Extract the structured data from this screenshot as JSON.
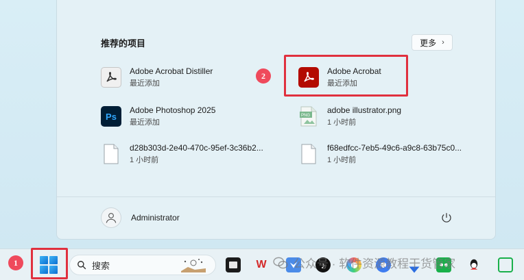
{
  "start_menu": {
    "section_title": "推荐的项目",
    "more_label": "更多",
    "recommended": [
      {
        "name": "Adobe Acrobat Distiller",
        "sub": "最近添加",
        "icon": "acrobat-distiller-icon"
      },
      {
        "name": "Adobe Acrobat",
        "sub": "最近添加",
        "icon": "adobe-acrobat-icon"
      },
      {
        "name": "Adobe Photoshop 2025",
        "sub": "最近添加",
        "icon": "photoshop-icon"
      },
      {
        "name": "adobe illustrator.png",
        "sub": "1 小时前",
        "icon": "png-file-icon"
      },
      {
        "name": "d28b303d-2e40-470c-95ef-3c36b2...",
        "sub": "1 小时前",
        "icon": "file-icon"
      },
      {
        "name": "f68edfcc-7eb5-49c6-a9c8-63b75c0...",
        "sub": "1 小时前",
        "icon": "file-icon"
      }
    ],
    "user_name": "Administrator",
    "ps_label": "Ps",
    "png_label": "PNG"
  },
  "annotations": {
    "badge_1": "1",
    "badge_2": "2",
    "color": "#e0303e"
  },
  "taskbar": {
    "search_label": "搜索",
    "watermark": "公众号 · 软件资源教程干货管家"
  },
  "colors": {
    "accent": "#0b6ed1",
    "acrobat": "#b30b00",
    "photoshop_bg": "#001e36",
    "photoshop_fg": "#31a8ff"
  }
}
